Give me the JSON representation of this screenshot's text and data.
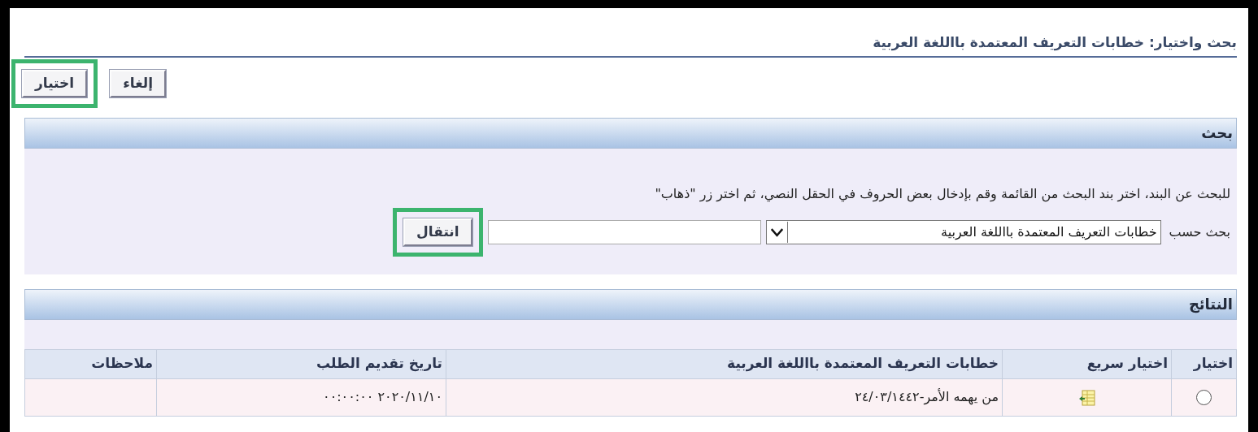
{
  "page_title": "بحث واختيار: خطابات التعريف المعتمدة بااللغة العربية",
  "buttons": [
    {
      "label": "إلغاء",
      "highlighted": false
    },
    {
      "label": "اختيار",
      "highlighted": true
    }
  ],
  "search": {
    "header": "بحث",
    "instructions": "للبحث عن البند، اختر بند البحث من القائمة وقم بإدخال بعض الحروف في الحقل النصي، ثم اختر زر \"ذهاب\"",
    "search_by_label": "بحث حسب",
    "search_by_value": "خطابات التعريف المعتمدة بااللغة العربية",
    "go_button": {
      "label": "انتقال",
      "highlighted": true
    }
  },
  "results": {
    "header": "النتائج",
    "columns": [
      "اختيار",
      "اختيار سريع",
      "خطابات التعريف المعتمدة بااللغة العربية",
      "تاريخ تقديم الطلب",
      "ملاحظات"
    ],
    "rows": [
      {
        "selected": false,
        "letter": "من يهمه الأمر-٢٤/٠٣/١٤٤٢",
        "date": "٢٠٢٠/١١/١٠ ٠٠:٠٠:٠٠"
      }
    ]
  }
}
